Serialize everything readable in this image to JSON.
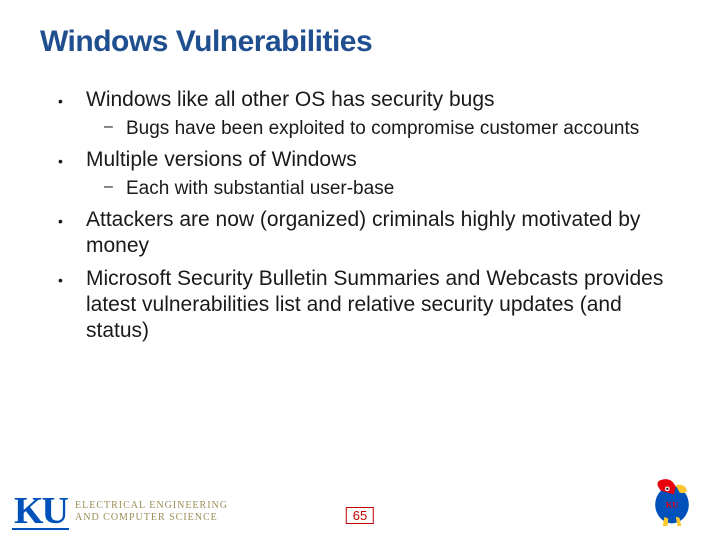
{
  "title": "Windows Vulnerabilities",
  "bullets": {
    "b1": "Windows like all other OS has security bugs",
    "b1s1": "Bugs have been exploited to compromise customer accounts",
    "b2": "Multiple versions of Windows",
    "b2s1": "Each with substantial user-base",
    "b3": "Attackers are now (organized) criminals highly motivated by money",
    "b4": "Microsoft Security Bulletin Summaries and Webcasts provides latest vulnerabilities list and relative security updates (and status)"
  },
  "footer": {
    "ku": "KU",
    "dept_line1": "ELECTRICAL ENGINEERING",
    "dept_line2": "AND COMPUTER SCIENCE",
    "page": "65"
  }
}
